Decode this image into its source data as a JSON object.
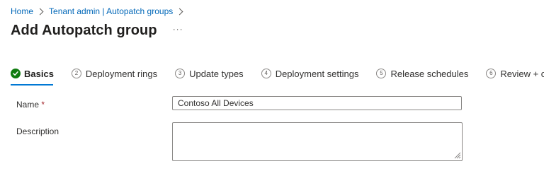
{
  "breadcrumb": {
    "items": [
      "Home",
      "Tenant admin | Autopatch groups"
    ]
  },
  "page": {
    "title": "Add Autopatch group",
    "more_label": "···"
  },
  "tabs": [
    {
      "number": "",
      "label": "Basics",
      "state": "completed-active"
    },
    {
      "number": "2",
      "label": "Deployment rings",
      "state": "pending"
    },
    {
      "number": "3",
      "label": "Update types",
      "state": "pending"
    },
    {
      "number": "4",
      "label": "Deployment settings",
      "state": "pending"
    },
    {
      "number": "5",
      "label": "Release schedules",
      "state": "pending"
    },
    {
      "number": "6",
      "label": "Review + create",
      "state": "pending"
    }
  ],
  "form": {
    "name": {
      "label": "Name",
      "required_marker": "*",
      "value": "Contoso All Devices"
    },
    "description": {
      "label": "Description",
      "value": ""
    }
  },
  "colors": {
    "accent": "#0078d4",
    "link": "#0067b8",
    "success": "#107c10",
    "required": "#a4262c"
  },
  "icons": {
    "breadcrumb_separator": "chevron-right-icon",
    "basics_status": "checkmark-circle-icon",
    "textarea_resize": "resize-grip-icon"
  }
}
